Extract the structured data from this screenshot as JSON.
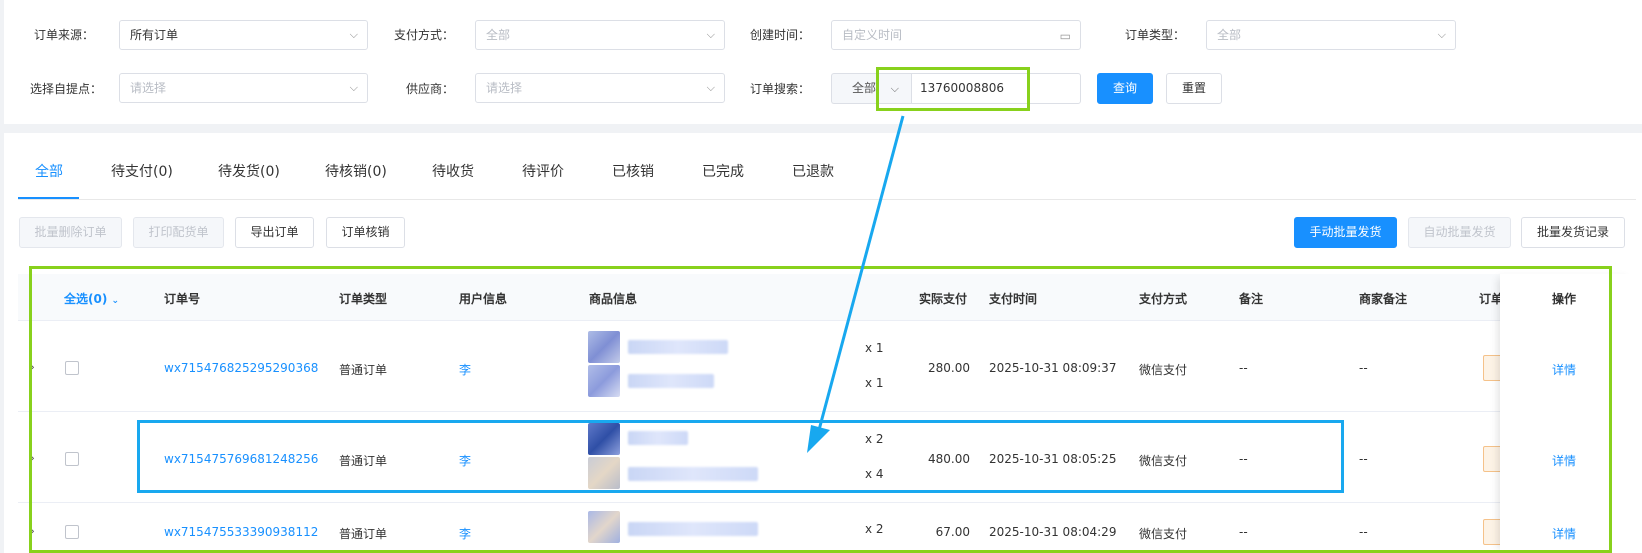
{
  "filters": {
    "order_source": {
      "label": "订单来源：",
      "value": "所有订单"
    },
    "payment_method": {
      "label": "支付方式：",
      "placeholder": "全部"
    },
    "created_time": {
      "label": "创建时间：",
      "placeholder": "自定义时间"
    },
    "order_type": {
      "label": "订单类型：",
      "placeholder": "全部"
    },
    "pickup_point": {
      "label": "选择自提点：",
      "placeholder": "请选择"
    },
    "supplier": {
      "label": "供应商：",
      "placeholder": "请选择"
    },
    "order_search": {
      "label": "订单搜索：",
      "prefix": "全部",
      "value": "13760008806"
    },
    "query_button": "查询",
    "reset_button": "重置"
  },
  "tabs": [
    "全部",
    "待支付(0)",
    "待发货(0)",
    "待核销(0)",
    "待收货",
    "待评价",
    "已核销",
    "已完成",
    "已退款"
  ],
  "toolbar": {
    "batch_delete": "批量删除订单",
    "print_picking": "打印配货单",
    "export": "导出订单",
    "verify": "订单核销",
    "manual_batch_ship": "手动批量发货",
    "auto_batch_ship": "自动批量发货",
    "batch_ship_records": "批量发货记录"
  },
  "table": {
    "headers": {
      "select_all": "全选(0)",
      "order_no": "订单号",
      "order_type": "订单类型",
      "user_info": "用户信息",
      "product_info": "商品信息",
      "actual_pay": "实际支付",
      "pay_time": "支付时间",
      "pay_method": "支付方式",
      "remark": "备注",
      "merchant_remark": "商家备注",
      "status_partial": "订单",
      "operation": "操作"
    },
    "rows": [
      {
        "order_no": "wx715476825295290368",
        "order_type": "普通订单",
        "user": "李",
        "qty1": "x 1",
        "qty2": "x 1",
        "amount": "280.00",
        "pay_time": "2025-10-31 08:09:37",
        "pay_method": "微信支付",
        "remark": "--",
        "merchant_remark": "--",
        "action": "详情"
      },
      {
        "order_no": "wx715475769681248256",
        "order_type": "普通订单",
        "user": "李",
        "qty1": "x 2",
        "qty2": "x 4",
        "amount": "480.00",
        "pay_time": "2025-10-31 08:05:25",
        "pay_method": "微信支付",
        "remark": "--",
        "merchant_remark": "--",
        "action": "详情"
      },
      {
        "order_no": "wx715475533390938112",
        "order_type": "普通订单",
        "user": "李",
        "qty1": "x 2",
        "amount": "67.00",
        "pay_time": "2025-10-31 08:04:29",
        "pay_method": "微信支付",
        "remark": "--",
        "merchant_remark": "--",
        "action": "详情"
      }
    ]
  },
  "colors": {
    "primary": "#1890ff",
    "highlight_green": "#88d11c",
    "highlight_blue": "#18a8ef"
  },
  "icons": [
    "chevron-down-icon",
    "calendar-icon",
    "expand-arrow-icon"
  ]
}
